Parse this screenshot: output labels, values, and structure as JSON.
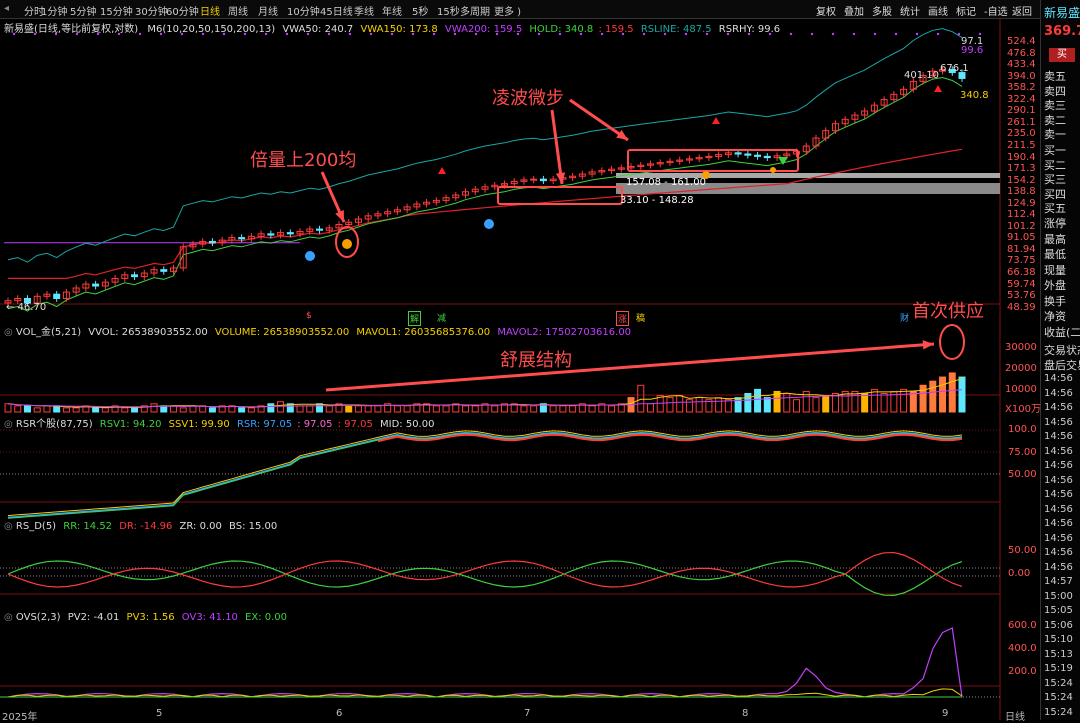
{
  "topbar": {
    "timeframes": [
      "分时",
      "1分钟",
      "5分钟",
      "15分钟",
      "30分钟",
      "60分钟",
      "日线",
      "周线",
      "月线",
      "10分钟",
      "45日线",
      "季线",
      "年线",
      "5秒",
      "15秒",
      "多周期",
      "更多 )"
    ],
    "active_index": 6,
    "buttons": [
      "复权",
      "叠加",
      "多股",
      "统计",
      "画线",
      "标记",
      "-自选",
      "返回"
    ]
  },
  "legend_main": {
    "title": "新易盛(日线,等比前复权,对数)",
    "m6": "M6(10,20,50,150,200,13)",
    "vwa50": "VWA50: 240.7",
    "vwa150": "VWA150: 173.8",
    "vwa200": "VWA200: 159.5",
    "hold": "HOLD: 340.8",
    "hold2": ": 159.5",
    "rsline": "RSLINE: 487.5",
    "rsrhy": "RSRHY: 99.6"
  },
  "legend_vol": {
    "name": "VOL_金(5,21)",
    "vvol": "VVOL: 26538903552.00",
    "volume": "VOLUME: 26538903552.00",
    "mavol1": "MAVOL1: 26035685376.00",
    "mavol2": "MAVOL2: 17502703616.00"
  },
  "legend_rsr": {
    "name": "RSR个股(87,75)",
    "rsv1": "RSV1: 94.20",
    "ssv1": "SSV1: 99.90",
    "rsr": "RSR: 97.05",
    "v2": ": 97.05",
    "v3": ": 97.05",
    "mid": "MID: 50.00"
  },
  "legend_rsd": {
    "name": "RS_D(5)",
    "rr": "RR: 14.52",
    "dr": "DR: -14.96",
    "zr": "ZR: 0.00",
    "bs": "BS: 15.00"
  },
  "legend_ovs": {
    "name": "OVS(2,3)",
    "pv2": "PV2: -4.01",
    "pv3": "PV3: 1.56",
    "ov3": "OV3: 41.10",
    "ex": "EX: 0.00"
  },
  "price_axis": [
    "524.4",
    "476.8",
    "433.4",
    "394.0",
    "358.2",
    "322.4",
    "290.1",
    "261.1",
    "235.0",
    "211.5",
    "190.4",
    "171.3",
    "154.2",
    "138.8",
    "124.9",
    "112.4",
    "101.2",
    "91.05",
    "81.94",
    "73.75",
    "66.38",
    "59.74",
    "53.76",
    "48.39"
  ],
  "vol_axis": [
    "30000",
    "20000",
    "10000",
    "X100万"
  ],
  "rsr_axis": [
    "100.0",
    "75.00",
    "50.00"
  ],
  "rsd_axis": [
    "50.00",
    "0.00"
  ],
  "ovs_axis": [
    "600.0",
    "400.0",
    "200.0"
  ],
  "x_axis": [
    "2025年",
    "5",
    "6",
    "7",
    "8",
    "9",
    "日线"
  ],
  "price_labels": {
    "low": "← 46.70",
    "high1": "97.1",
    "high2": "99.6",
    "p676": "676.1",
    "p401": "401.10",
    "p340": "340.8"
  },
  "ranges": {
    "r1": "157.08 - 161.00",
    "r2": "33.10 - 148.28"
  },
  "annotations": {
    "a1": "倍量上200均",
    "a2": "凌波微步",
    "a3": "舒展结构",
    "a4": "首次供应"
  },
  "event_marks": {
    "s": "$",
    "jie": "解",
    "jian": "减",
    "zhang": "涨",
    "gao": "稿",
    "cai": "财"
  },
  "right_panel": {
    "stock": "新易盛",
    "price": "369.7",
    "sell_btn": "买",
    "asks": [
      "卖五",
      "卖四",
      "卖三",
      "卖二",
      "卖一"
    ],
    "bids": [
      "买一",
      "买二",
      "买三",
      "买四",
      "买五"
    ],
    "stats": [
      "涨停",
      "最高",
      "最低",
      "现量",
      "外盘",
      "换手",
      "净资",
      "收益(二"
    ],
    "trade_status": "交易状态",
    "after_hours": "盘后交易",
    "times": [
      "14:56",
      "14:56",
      "14:56",
      "14:56",
      "14:56",
      "14:56",
      "14:56",
      "14:56",
      "14:56",
      "14:56",
      "14:56",
      "14:56",
      "14:56",
      "14:56",
      "14:57",
      "15:00",
      "15:05",
      "15:06",
      "15:10",
      "15:13",
      "15:19",
      "15:24",
      "15:24",
      "15:24"
    ]
  },
  "colors": {
    "up": "#ff3b3b",
    "down": "#5ee7ff",
    "orange": "#ff7a3c",
    "gold": "#ffb300",
    "annotation": "#ff4d4d",
    "ma_green": "#3fd03f",
    "ma_teal": "#1aa6a6",
    "ma_red": "#e0202a",
    "magenta": "#c040ff"
  },
  "chart_data": {
    "type": "line",
    "price_range": [
      46.7,
      524.4
    ],
    "closes": [
      49,
      50,
      48,
      51,
      52,
      50,
      53,
      55,
      57,
      56,
      58,
      60,
      62,
      61,
      63,
      65,
      64,
      66,
      80,
      82,
      84,
      83,
      85,
      87,
      86,
      88,
      90,
      89,
      91,
      90,
      92,
      94,
      93,
      95,
      98,
      100,
      103,
      106,
      108,
      110,
      112,
      115,
      118,
      120,
      122,
      125,
      128,
      132,
      135,
      138,
      140,
      142,
      145,
      147,
      148,
      146,
      148,
      150,
      152,
      155,
      158,
      160,
      162,
      164,
      166,
      168,
      170,
      172,
      174,
      176,
      178,
      180,
      182,
      185,
      188,
      186,
      184,
      182,
      180,
      183,
      186,
      190,
      200,
      215,
      230,
      245,
      255,
      265,
      275,
      290,
      305,
      320,
      335,
      360,
      380,
      395,
      401,
      390,
      369.7
    ],
    "volumes": [
      4,
      3,
      3,
      2,
      3,
      3,
      2,
      2,
      3,
      2,
      2,
      3,
      2,
      2,
      3,
      4,
      3,
      3,
      2,
      3,
      3,
      2,
      3,
      3,
      2,
      2,
      3,
      4,
      5,
      4,
      3,
      3,
      4,
      3,
      4,
      3,
      3,
      3,
      3,
      4,
      3,
      3,
      4,
      4,
      3,
      3,
      4,
      3,
      3,
      4,
      3,
      4,
      4,
      3,
      3,
      4,
      3,
      3,
      3,
      4,
      3,
      4,
      3,
      4,
      7,
      13,
      4,
      8,
      7,
      8,
      6,
      7,
      6,
      7,
      6,
      7,
      9,
      11,
      7,
      10,
      9,
      6,
      10,
      7,
      8,
      9,
      10,
      10,
      9,
      11,
      9,
      10,
      11,
      10,
      13,
      15,
      17,
      19,
      17,
      26,
      34,
      14
    ]
  }
}
